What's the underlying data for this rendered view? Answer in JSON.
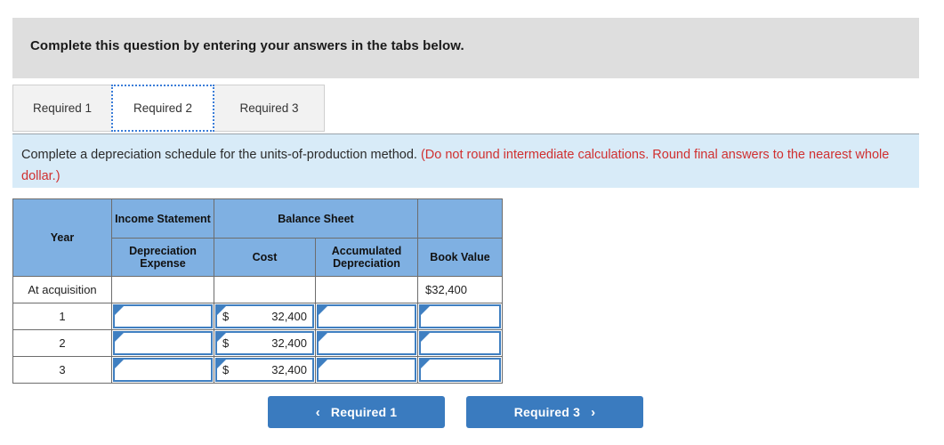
{
  "banner": {
    "text": "Complete this question by entering your answers in the tabs below."
  },
  "tabs": {
    "items": [
      {
        "label": "Required 1",
        "active": false
      },
      {
        "label": "Required 2",
        "active": true
      },
      {
        "label": "Required 3",
        "active": false
      }
    ]
  },
  "instruction": {
    "main": "Complete a depreciation schedule for the units-of-production method.",
    "note": "(Do not round intermediate calculations. Round final answers to the nearest whole dollar.)",
    "note_color": "#d03030"
  },
  "table": {
    "header": {
      "year": "Year",
      "income_statement": "Income Statement",
      "balance_sheet": "Balance Sheet",
      "depreciation_expense": "Depreciation Expense",
      "cost": "Cost",
      "accumulated_depreciation": "Accumulated Depreciation",
      "book_value": "Book Value"
    },
    "rows": [
      {
        "year": "At acquisition",
        "depreciation_expense": "",
        "cost_currency": "",
        "cost": "",
        "accumulated_depreciation": "",
        "book_value_currency": "$",
        "book_value": "32,400"
      },
      {
        "year": "1",
        "depreciation_expense": "",
        "cost_currency": "$",
        "cost": "32,400",
        "accumulated_depreciation": "",
        "book_value_currency": "",
        "book_value": ""
      },
      {
        "year": "2",
        "depreciation_expense": "",
        "cost_currency": "$",
        "cost": "32,400",
        "accumulated_depreciation": "",
        "book_value_currency": "",
        "book_value": ""
      },
      {
        "year": "3",
        "depreciation_expense": "",
        "cost_currency": "$",
        "cost": "32,400",
        "accumulated_depreciation": "",
        "book_value_currency": "",
        "book_value": ""
      }
    ]
  },
  "nav": {
    "prev_label": "Required 1",
    "prev_icon": "chevron-left-icon",
    "next_label": "Required 3",
    "next_icon": "chevron-right-icon",
    "prev_chevron": "‹",
    "next_chevron": "›",
    "accent_color": "#3a7bbf"
  }
}
